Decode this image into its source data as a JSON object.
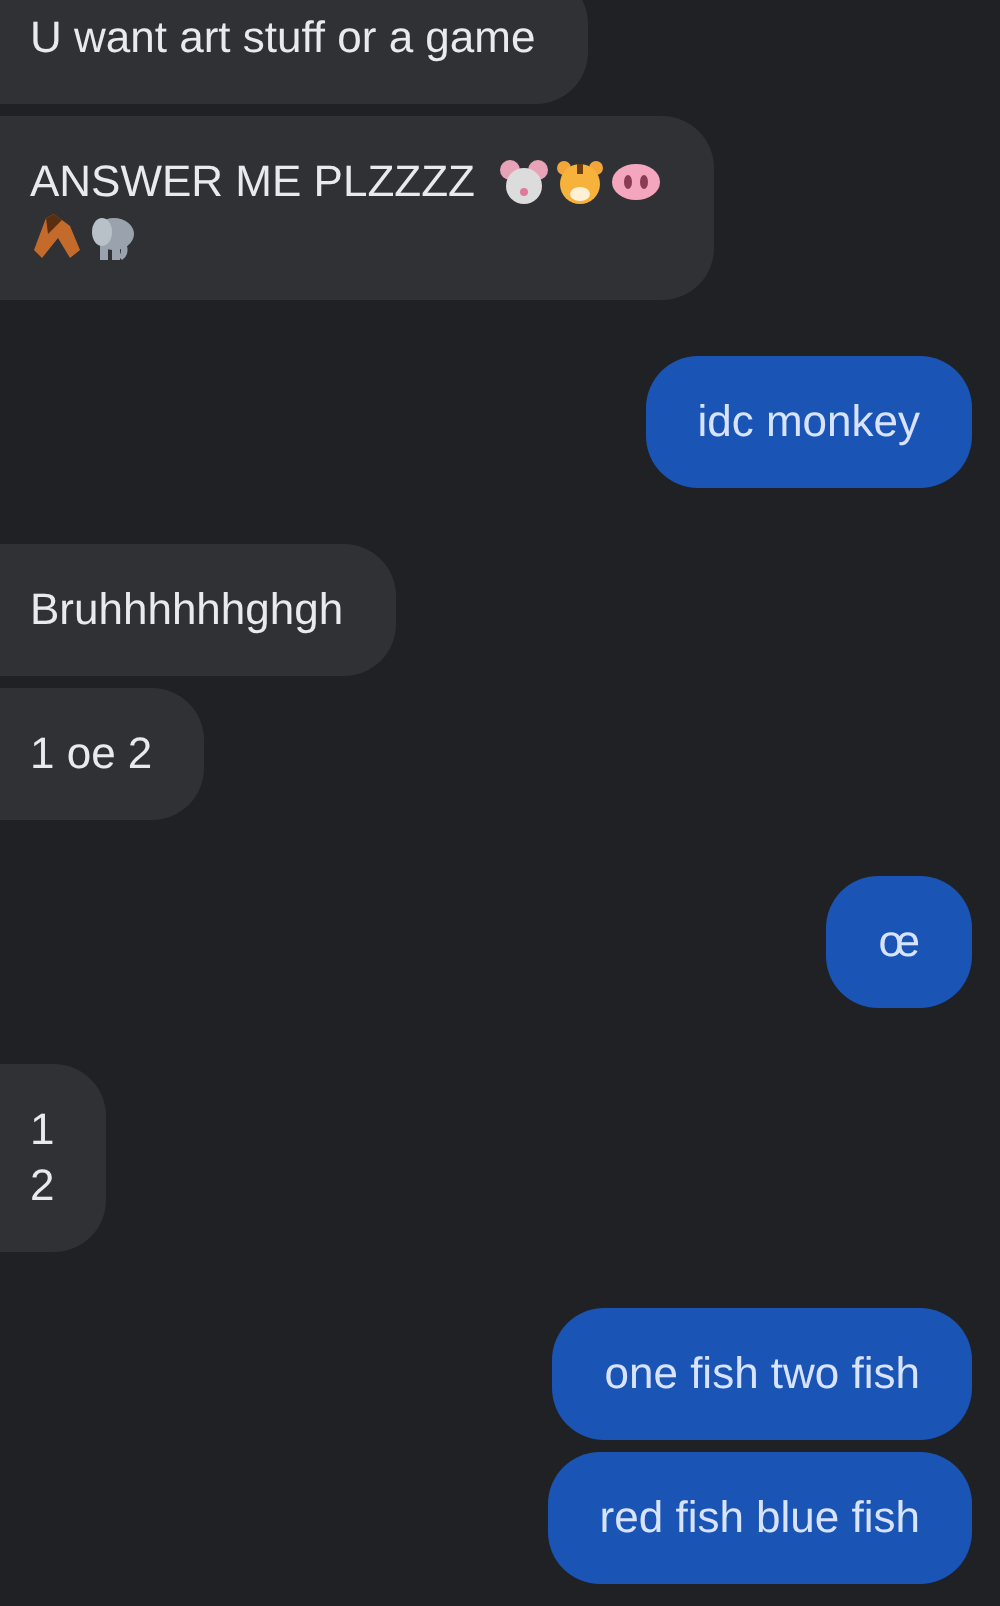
{
  "messages": [
    {
      "kind": "incoming",
      "text": "U want art stuff or a game"
    },
    {
      "kind": "incoming",
      "text": "ANSWER ME PLZZZZ",
      "emoji": [
        {
          "kind": "mouse"
        },
        {
          "kind": "tiger"
        },
        {
          "kind": "pig"
        },
        {
          "kind": "horse"
        },
        {
          "kind": "elephant"
        }
      ]
    },
    {
      "kind": "outgoing",
      "text": "idc monkey"
    },
    {
      "kind": "incoming",
      "text": "Bruhhhhhhghgh"
    },
    {
      "kind": "incoming",
      "text": "1 oe 2"
    },
    {
      "kind": "outgoing",
      "text": "œ"
    },
    {
      "kind": "incoming",
      "text": "1\n2"
    },
    {
      "kind": "outgoing",
      "text": "one fish two fish"
    },
    {
      "kind": "outgoing",
      "text": "red fish blue fish"
    }
  ]
}
